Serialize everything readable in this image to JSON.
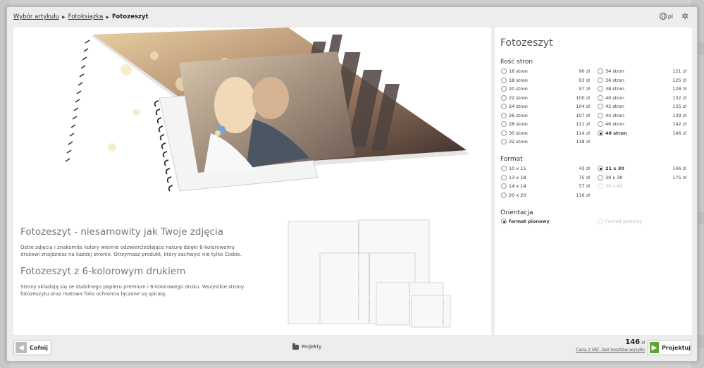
{
  "breadcrumb": {
    "items": [
      "Wybór artykułu",
      "Fotoksiążka"
    ],
    "current": "Fotozeszyt"
  },
  "header": {
    "language": "pl"
  },
  "description": {
    "heading1": "Fotozeszyt - niesamowity jak Twoje zdjęcia",
    "text1": "Ostre zdjęcia i znakomite kolory wiernie odzwierciedlające naturę dzięki 6-kolorowemu drukowi znajdziesz na każdej stronie. Otrzymasz produkt, który zachwyci nie tylko Ciebie.",
    "heading2": "Fotozeszyt z 6-kolorowym drukiem",
    "text2": "Strony składają się ze stabilnego papieru premium i 6-kolorowego druku. Wszystkie strony fotozeszytu oraz matowa folia ochronna łączone są spiralą."
  },
  "product": {
    "title": "Fotozeszyt",
    "pages_title": "Ilość stron",
    "pages": [
      {
        "label": "16 stron",
        "price": "90 zł"
      },
      {
        "label": "18 stron",
        "price": "93 zł"
      },
      {
        "label": "20 stron",
        "price": "97 zł"
      },
      {
        "label": "22 stron",
        "price": "100 zł"
      },
      {
        "label": "24 stron",
        "price": "104 zł"
      },
      {
        "label": "26 stron",
        "price": "107 zł"
      },
      {
        "label": "28 stron",
        "price": "111 zł"
      },
      {
        "label": "30 stron",
        "price": "114 zł"
      },
      {
        "label": "32 stron",
        "price": "118 zł"
      },
      {
        "label": "34 stron",
        "price": "121 zł"
      },
      {
        "label": "36 stron",
        "price": "125 zł"
      },
      {
        "label": "38 stron",
        "price": "128 zł"
      },
      {
        "label": "40 stron",
        "price": "132 zł"
      },
      {
        "label": "42 stron",
        "price": "135 zł"
      },
      {
        "label": "44 stron",
        "price": "139 zł"
      },
      {
        "label": "46 stron",
        "price": "142 zł"
      },
      {
        "label": "48 stron",
        "price": "146 zł",
        "selected": true
      }
    ],
    "format_title": "Format",
    "formats": [
      {
        "label": "10 x 15",
        "price": "43 zł"
      },
      {
        "label": "13 x 18",
        "price": "75 zł"
      },
      {
        "label": "14 x 14",
        "price": "57 zł"
      },
      {
        "label": "20 x 20",
        "price": "116 zł"
      },
      {
        "label": "21 x 30",
        "price": "146 zł",
        "selected": true
      },
      {
        "label": "30 x 30",
        "price": "175 zł"
      },
      {
        "label": "30 x 42",
        "price": "",
        "disabled": true
      }
    ],
    "orientation_title": "Orientacja",
    "orientations": [
      {
        "label": "format pionowy",
        "selected": true
      },
      {
        "label": "Format poziomy",
        "disabled": true
      }
    ]
  },
  "footer": {
    "back_label": "Cofnij",
    "projects_label": "Projekty",
    "total_value": "146",
    "total_currency": "zł",
    "vat_note": "Cena z VAT, bez kosztów wysyłki",
    "project_label": "Projektuj"
  },
  "colors": {
    "accent_green": "#5ba633",
    "panel_bg": "#ffffff",
    "modal_bg": "#ededed"
  }
}
